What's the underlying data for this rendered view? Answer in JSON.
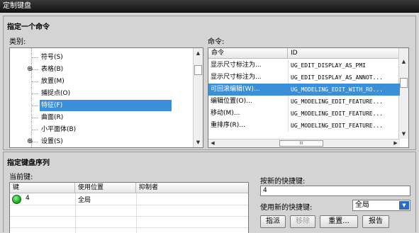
{
  "window": {
    "title": "定制键盘"
  },
  "section1": {
    "title": "指定一个命令",
    "category_label": "类别:",
    "command_label": "命令:"
  },
  "tree": {
    "items": [
      {
        "label": "符号(S)",
        "selected": false,
        "expand": ""
      },
      {
        "label": "表格(B)",
        "selected": false,
        "expand": "⊕"
      },
      {
        "label": "放置(M)",
        "selected": false,
        "expand": ""
      },
      {
        "label": "捕捉点(O)",
        "selected": false,
        "expand": ""
      },
      {
        "label": "特征(F)",
        "selected": true,
        "expand": ""
      },
      {
        "label": "曲面(R)",
        "selected": false,
        "expand": ""
      },
      {
        "label": "小平面体(B)",
        "selected": false,
        "expand": ""
      },
      {
        "label": "设置(S)",
        "selected": false,
        "expand": "⊕"
      }
    ]
  },
  "commands": {
    "headers": [
      "命令",
      "ID"
    ],
    "rows": [
      {
        "cmd": "显示尺寸标注为...",
        "id": "UG_EDIT_DISPLAY_AS_PMI",
        "selected": false
      },
      {
        "cmd": "显示尺寸标注为...",
        "id": "UG_EDIT_DISPLAY_AS_ANNOT...",
        "selected": false
      },
      {
        "cmd": "可回滚编辑(W)...",
        "id": "UG_MODELING_EDIT_WITH_RO...",
        "selected": true
      },
      {
        "cmd": "编辑位置(O)...",
        "id": "UG_MODELING_EDIT_FEATURE...",
        "selected": false
      },
      {
        "cmd": "移动(M)...",
        "id": "UG_MODELING_EDIT_FEATURE...",
        "selected": false
      },
      {
        "cmd": "重排序(R)...",
        "id": "UG_MODELING_EDIT_FEATURE...",
        "selected": false
      }
    ]
  },
  "section2": {
    "title": "指定键盘序列",
    "current_label": "当前键:",
    "new_shortcut_label": "按新的快捷键:",
    "use_label": "使用新的快捷键:"
  },
  "current_keys": {
    "headers": [
      "键",
      "使用位置",
      "抑制者"
    ],
    "rows": [
      {
        "key": "4",
        "location": "全局",
        "suppressor": ""
      }
    ]
  },
  "new_shortcut": {
    "value": "4"
  },
  "scope": {
    "value": "全局"
  },
  "buttons": {
    "assign": "指派",
    "remove": "移除",
    "reset": "重置...",
    "report": "报告"
  }
}
